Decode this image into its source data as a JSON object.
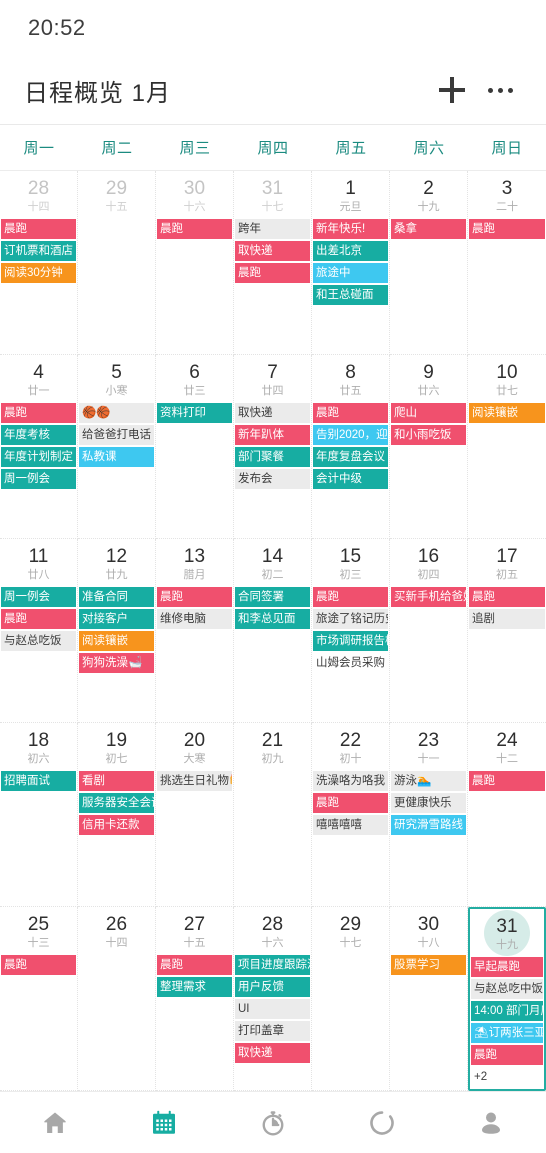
{
  "status": {
    "time": "20:52"
  },
  "appbar": {
    "title": "日程概览  1月",
    "add_label": "+",
    "more_label": "···",
    "icons": {
      "add": "plus-icon",
      "more": "more-horizontal-icon"
    }
  },
  "weekdays": [
    "周一",
    "周二",
    "周三",
    "周四",
    "周五",
    "周六",
    "周日"
  ],
  "colors": {
    "pink": "#f0506e",
    "teal": "#17ada2",
    "orange": "#f7941d",
    "blue": "#3ec8f0",
    "grey": "#ebebeb",
    "accent": "#1b8b80",
    "selected_circle": "#d6ece8"
  },
  "weeks": [
    [
      {
        "day": "28",
        "lunar": "十四",
        "muted": true,
        "selected": false,
        "events": [
          {
            "text": "晨跑",
            "color": "pink"
          },
          {
            "text": "订机票和酒店",
            "color": "teal"
          },
          {
            "text": "阅读30分钟",
            "color": "orange"
          }
        ]
      },
      {
        "day": "29",
        "lunar": "十五",
        "muted": true,
        "selected": false,
        "events": []
      },
      {
        "day": "30",
        "lunar": "十六",
        "muted": true,
        "selected": false,
        "events": [
          {
            "text": "晨跑",
            "color": "pink"
          }
        ]
      },
      {
        "day": "31",
        "lunar": "十七",
        "muted": true,
        "selected": false,
        "events": [
          {
            "text": "跨年",
            "color": "grey"
          },
          {
            "text": "取快递",
            "color": "pink"
          },
          {
            "text": "晨跑",
            "color": "pink"
          }
        ]
      },
      {
        "day": "1",
        "lunar": "元旦",
        "muted": false,
        "selected": false,
        "events": [
          {
            "text": "新年快乐!",
            "color": "pink"
          },
          {
            "text": "出差北京",
            "color": "teal"
          },
          {
            "text": "旅途中",
            "color": "blue"
          },
          {
            "text": "和王总碰面",
            "color": "teal"
          }
        ]
      },
      {
        "day": "2",
        "lunar": "十九",
        "muted": false,
        "selected": false,
        "events": [
          {
            "text": "桑拿",
            "color": "pink"
          }
        ]
      },
      {
        "day": "3",
        "lunar": "二十",
        "muted": false,
        "selected": false,
        "events": [
          {
            "text": "晨跑",
            "color": "pink"
          }
        ]
      }
    ],
    [
      {
        "day": "4",
        "lunar": "廿一",
        "muted": false,
        "selected": false,
        "events": [
          {
            "text": "晨跑",
            "color": "pink"
          },
          {
            "text": "年度考核",
            "color": "teal"
          },
          {
            "text": "年度计划制定",
            "color": "teal"
          },
          {
            "text": "周一例会",
            "color": "teal"
          }
        ]
      },
      {
        "day": "5",
        "lunar": "小寒",
        "muted": false,
        "selected": false,
        "events": [
          {
            "text": "🏀🏀",
            "color": "grey"
          },
          {
            "text": "给爸爸打电话",
            "color": "grey"
          },
          {
            "text": "私教课",
            "color": "blue"
          }
        ]
      },
      {
        "day": "6",
        "lunar": "廿三",
        "muted": false,
        "selected": false,
        "events": [
          {
            "text": "资料打印",
            "color": "teal"
          }
        ]
      },
      {
        "day": "7",
        "lunar": "廿四",
        "muted": false,
        "selected": false,
        "events": [
          {
            "text": "取快递",
            "color": "grey"
          },
          {
            "text": "新年趴体",
            "color": "pink"
          },
          {
            "text": "部门聚餐",
            "color": "teal"
          },
          {
            "text": "发布会",
            "color": "grey"
          }
        ]
      },
      {
        "day": "8",
        "lunar": "廿五",
        "muted": false,
        "selected": false,
        "events": [
          {
            "text": "晨跑",
            "color": "pink"
          },
          {
            "text": "告别2020，迎",
            "color": "blue"
          },
          {
            "text": "年度复盘会议",
            "color": "teal"
          },
          {
            "text": "会计中级",
            "color": "teal"
          }
        ]
      },
      {
        "day": "9",
        "lunar": "廿六",
        "muted": false,
        "selected": false,
        "events": [
          {
            "text": "爬山",
            "color": "pink"
          },
          {
            "text": "和小雨吃饭",
            "color": "pink"
          }
        ]
      },
      {
        "day": "10",
        "lunar": "廿七",
        "muted": false,
        "selected": false,
        "events": [
          {
            "text": "阅读镶嵌",
            "color": "orange"
          }
        ]
      }
    ],
    [
      {
        "day": "11",
        "lunar": "廿八",
        "muted": false,
        "selected": false,
        "events": [
          {
            "text": "周一例会",
            "color": "teal"
          },
          {
            "text": "晨跑",
            "color": "pink"
          },
          {
            "text": "与赵总吃饭",
            "color": "grey"
          }
        ]
      },
      {
        "day": "12",
        "lunar": "廿九",
        "muted": false,
        "selected": false,
        "events": [
          {
            "text": "准备合同",
            "color": "teal"
          },
          {
            "text": "对接客户",
            "color": "teal"
          },
          {
            "text": "阅读镶嵌",
            "color": "orange"
          },
          {
            "text": "狗狗洗澡🛁",
            "color": "pink"
          }
        ]
      },
      {
        "day": "13",
        "lunar": "腊月",
        "muted": false,
        "selected": false,
        "events": [
          {
            "text": "晨跑",
            "color": "pink"
          },
          {
            "text": "维修电脑",
            "color": "grey"
          }
        ]
      },
      {
        "day": "14",
        "lunar": "初二",
        "muted": false,
        "selected": false,
        "events": [
          {
            "text": "合同签署",
            "color": "teal"
          },
          {
            "text": "和李总见面",
            "color": "teal"
          }
        ]
      },
      {
        "day": "15",
        "lunar": "初三",
        "muted": false,
        "selected": false,
        "events": [
          {
            "text": "晨跑",
            "color": "pink"
          },
          {
            "text": "旅途了铭记历史",
            "color": "grey"
          },
          {
            "text": "市场调研报告模",
            "color": "teal"
          },
          {
            "text": "山姆会员采购",
            "color": "plain"
          }
        ]
      },
      {
        "day": "16",
        "lunar": "初四",
        "muted": false,
        "selected": false,
        "events": [
          {
            "text": "买新手机给爸妈",
            "color": "pink"
          }
        ]
      },
      {
        "day": "17",
        "lunar": "初五",
        "muted": false,
        "selected": false,
        "events": [
          {
            "text": "晨跑",
            "color": "pink"
          },
          {
            "text": "追剧",
            "color": "grey"
          }
        ]
      }
    ],
    [
      {
        "day": "18",
        "lunar": "初六",
        "muted": false,
        "selected": false,
        "events": [
          {
            "text": "招聘面试",
            "color": "teal"
          }
        ]
      },
      {
        "day": "19",
        "lunar": "初七",
        "muted": false,
        "selected": false,
        "events": [
          {
            "text": "看剧",
            "color": "pink"
          },
          {
            "text": "服务器安全会议",
            "color": "teal"
          },
          {
            "text": "信用卡还款",
            "color": "pink"
          }
        ]
      },
      {
        "day": "20",
        "lunar": "大寒",
        "muted": false,
        "selected": false,
        "events": [
          {
            "text": "挑选生日礼物🎁",
            "color": "grey"
          }
        ]
      },
      {
        "day": "21",
        "lunar": "初九",
        "muted": false,
        "selected": false,
        "events": []
      },
      {
        "day": "22",
        "lunar": "初十",
        "muted": false,
        "selected": false,
        "events": [
          {
            "text": "洗澡咯为咯我",
            "color": "grey"
          },
          {
            "text": "晨跑",
            "color": "pink"
          },
          {
            "text": "嘻嘻嘻嘻",
            "color": "grey"
          }
        ]
      },
      {
        "day": "23",
        "lunar": "十一",
        "muted": false,
        "selected": false,
        "events": [
          {
            "text": "游泳🏊",
            "color": "grey"
          },
          {
            "text": "更健康快乐",
            "color": "grey"
          },
          {
            "text": "研究滑雪路线",
            "color": "blue"
          }
        ]
      },
      {
        "day": "24",
        "lunar": "十二",
        "muted": false,
        "selected": false,
        "events": [
          {
            "text": "晨跑",
            "color": "pink"
          }
        ]
      }
    ],
    [
      {
        "day": "25",
        "lunar": "十三",
        "muted": false,
        "selected": false,
        "events": [
          {
            "text": "晨跑",
            "color": "pink"
          }
        ]
      },
      {
        "day": "26",
        "lunar": "十四",
        "muted": false,
        "selected": false,
        "events": []
      },
      {
        "day": "27",
        "lunar": "十五",
        "muted": false,
        "selected": false,
        "events": [
          {
            "text": "晨跑",
            "color": "pink"
          },
          {
            "text": "整理需求",
            "color": "teal"
          }
        ]
      },
      {
        "day": "28",
        "lunar": "十六",
        "muted": false,
        "selected": false,
        "events": [
          {
            "text": "项目进度跟踪汇",
            "color": "teal"
          },
          {
            "text": "用户反馈",
            "color": "teal"
          },
          {
            "text": "UI",
            "color": "grey"
          },
          {
            "text": "打印盖章",
            "color": "grey"
          },
          {
            "text": "取快递",
            "color": "pink"
          }
        ]
      },
      {
        "day": "29",
        "lunar": "十七",
        "muted": false,
        "selected": false,
        "events": []
      },
      {
        "day": "30",
        "lunar": "十八",
        "muted": false,
        "selected": false,
        "events": [
          {
            "text": "股票学习",
            "color": "orange"
          }
        ]
      },
      {
        "day": "31",
        "lunar": "十九",
        "muted": false,
        "selected": true,
        "events": [
          {
            "text": "早起晨跑",
            "color": "pink"
          },
          {
            "text": "与赵总吃中饭",
            "color": "grey"
          },
          {
            "text": "14:00 部门月度",
            "color": "teal"
          },
          {
            "text": "⛱订两张三亚的",
            "color": "blue"
          },
          {
            "text": "晨跑",
            "color": "pink"
          },
          {
            "text": "+2",
            "color": "plain"
          }
        ]
      }
    ]
  ],
  "bottomnav": [
    {
      "icon": "home-icon",
      "active": false
    },
    {
      "icon": "calendar-icon",
      "active": true
    },
    {
      "icon": "timer-icon",
      "active": false
    },
    {
      "icon": "progress-ring-icon",
      "active": false
    },
    {
      "icon": "person-icon",
      "active": false
    }
  ]
}
